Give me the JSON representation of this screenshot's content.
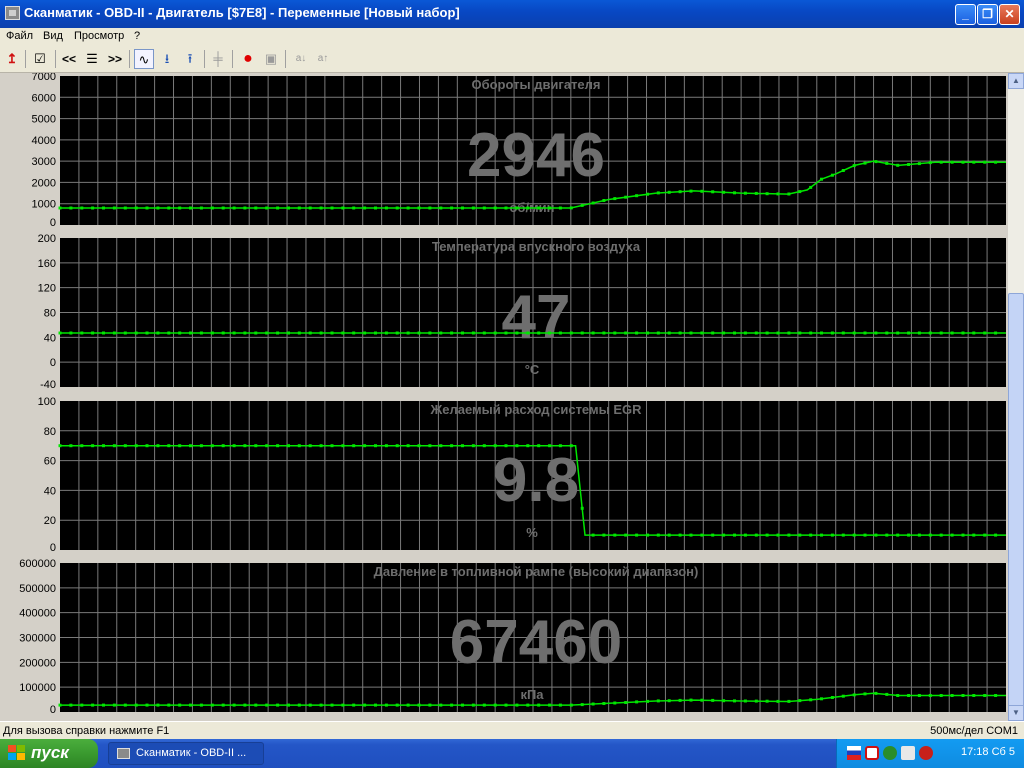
{
  "window": {
    "title": "Сканматик - OBD-II - Двигатель [$7E8] - Переменные [Новый набор]",
    "minimize": "_",
    "maximize": "❐",
    "close": "✕"
  },
  "menu": [
    "Файл",
    "Вид",
    "Просмотр",
    "?"
  ],
  "toolbar": {
    "buttons": [
      {
        "icon": "exit-arrow-icon",
        "glyph": "↥"
      },
      {
        "icon": "checklist-icon",
        "glyph": "☑"
      },
      {
        "icon": "prev-icon",
        "glyph": "<<"
      },
      {
        "icon": "list-icon",
        "glyph": "☰"
      },
      {
        "icon": "next-icon",
        "glyph": ">>"
      },
      {
        "icon": "graph-icon",
        "glyph": "∿"
      },
      {
        "icon": "download-icon",
        "glyph": "⭳"
      },
      {
        "icon": "upload-icon",
        "glyph": "⭱"
      },
      {
        "icon": "pin-icon",
        "glyph": "╪"
      },
      {
        "icon": "record-icon",
        "glyph": "●"
      },
      {
        "icon": "save-icon",
        "glyph": "▣"
      },
      {
        "icon": "sort-down-icon",
        "glyph": "a↓"
      },
      {
        "icon": "sort-up-icon",
        "glyph": "a↑"
      }
    ]
  },
  "colors": {
    "plot_bg": "#000000",
    "grid": "#7a7a7a",
    "line": "#00e600",
    "big_value": "#6e6e6e",
    "panel_bg": "#d4d0c8"
  },
  "chart_data": [
    {
      "type": "line",
      "title": "Обороты двигателя",
      "value": "2946",
      "unit": "об/мин",
      "ylim": [
        0,
        7000
      ],
      "yticks": [
        "7000",
        "6000",
        "5000",
        "4000",
        "3000",
        "2000",
        "1000",
        "0"
      ],
      "xlim": [
        0,
        100
      ],
      "series": [
        {
          "x": [
            0,
            54,
            58,
            63,
            67,
            72,
            77,
            79,
            80.5,
            82,
            84,
            86,
            88.6,
            92.5,
            100
          ],
          "y": [
            800,
            800,
            1200,
            1500,
            1600,
            1500,
            1450,
            1650,
            2150,
            2400,
            2800,
            3000,
            2800,
            2950,
            2950
          ]
        }
      ]
    },
    {
      "type": "line",
      "title": "Температура впускного воздуха",
      "value": "47",
      "unit": "°C",
      "ylim": [
        -40,
        200
      ],
      "yticks": [
        "200",
        "160",
        "120",
        "80",
        "40",
        "0",
        "-40"
      ],
      "xlim": [
        0,
        100
      ],
      "series": [
        {
          "x": [
            0,
            100
          ],
          "y": [
            47,
            47
          ]
        }
      ]
    },
    {
      "type": "line",
      "title": "Желаемый расход системы EGR",
      "value": "9.8",
      "unit": "%",
      "ylim": [
        0,
        100
      ],
      "yticks": [
        "100",
        "80",
        "60",
        "40",
        "20",
        "0"
      ],
      "xlim": [
        0,
        100
      ],
      "series": [
        {
          "x": [
            0,
            54.5,
            55.5,
            100
          ],
          "y": [
            70,
            70,
            10,
            10
          ]
        }
      ]
    },
    {
      "type": "line",
      "title": "Давление в топливной рампе (высокий диапазон)",
      "value": "67460",
      "unit": "кПа",
      "ylim": [
        0,
        650000
      ],
      "yticks": [
        "600000",
        "500000",
        "400000",
        "300000",
        "200000",
        "100000",
        "0"
      ],
      "xlim": [
        0,
        100
      ],
      "series": [
        {
          "x": [
            0,
            54,
            58,
            63,
            67,
            72,
            77,
            80,
            84,
            86,
            88.6,
            100
          ],
          "y": [
            30000,
            30000,
            38000,
            48000,
            52000,
            48000,
            46000,
            55000,
            75000,
            82000,
            72000,
            72000
          ]
        }
      ]
    }
  ],
  "statusbar": {
    "help": "Для вызова справки нажмите F1",
    "info": "500мс/дел COM1"
  },
  "taskbar": {
    "start": "пуск",
    "task": "Сканматик - OBD-II ...",
    "clock": "17:18 Сб 5"
  }
}
